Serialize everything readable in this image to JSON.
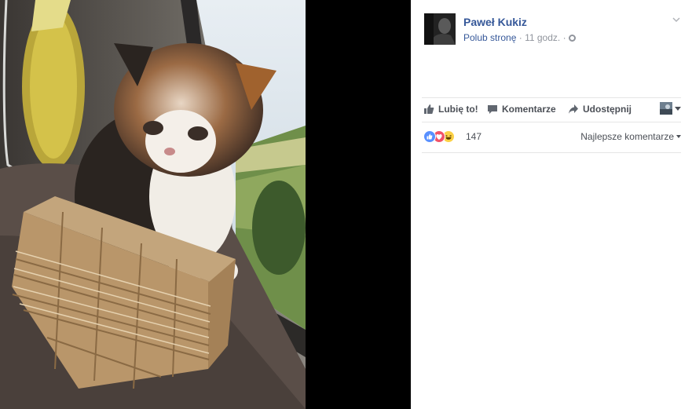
{
  "post": {
    "page_name": "Paweł Kukiz",
    "like_page_label": "Polub stronę",
    "separator": "·",
    "time": "11 godz.",
    "separator2": "·"
  },
  "actions": {
    "like_label": "Lubię to!",
    "comment_label": "Komentarze",
    "share_label": "Udostępnij"
  },
  "reactions": {
    "count": "147",
    "types": [
      "like",
      "love",
      "haha"
    ],
    "sort_label": "Najlepsze komentarze"
  },
  "icons": {
    "like": "thumbs-up-icon",
    "comment": "speech-bubble-icon",
    "share": "share-arrow-icon",
    "privacy": "globe-icon",
    "options": "chevron-down-icon"
  },
  "colors": {
    "link": "#365899",
    "meta": "#90949c",
    "text": "#4b4f56",
    "like_blue": "#5890ff",
    "love_red": "#f25268",
    "haha_yellow": "#fcd146"
  }
}
